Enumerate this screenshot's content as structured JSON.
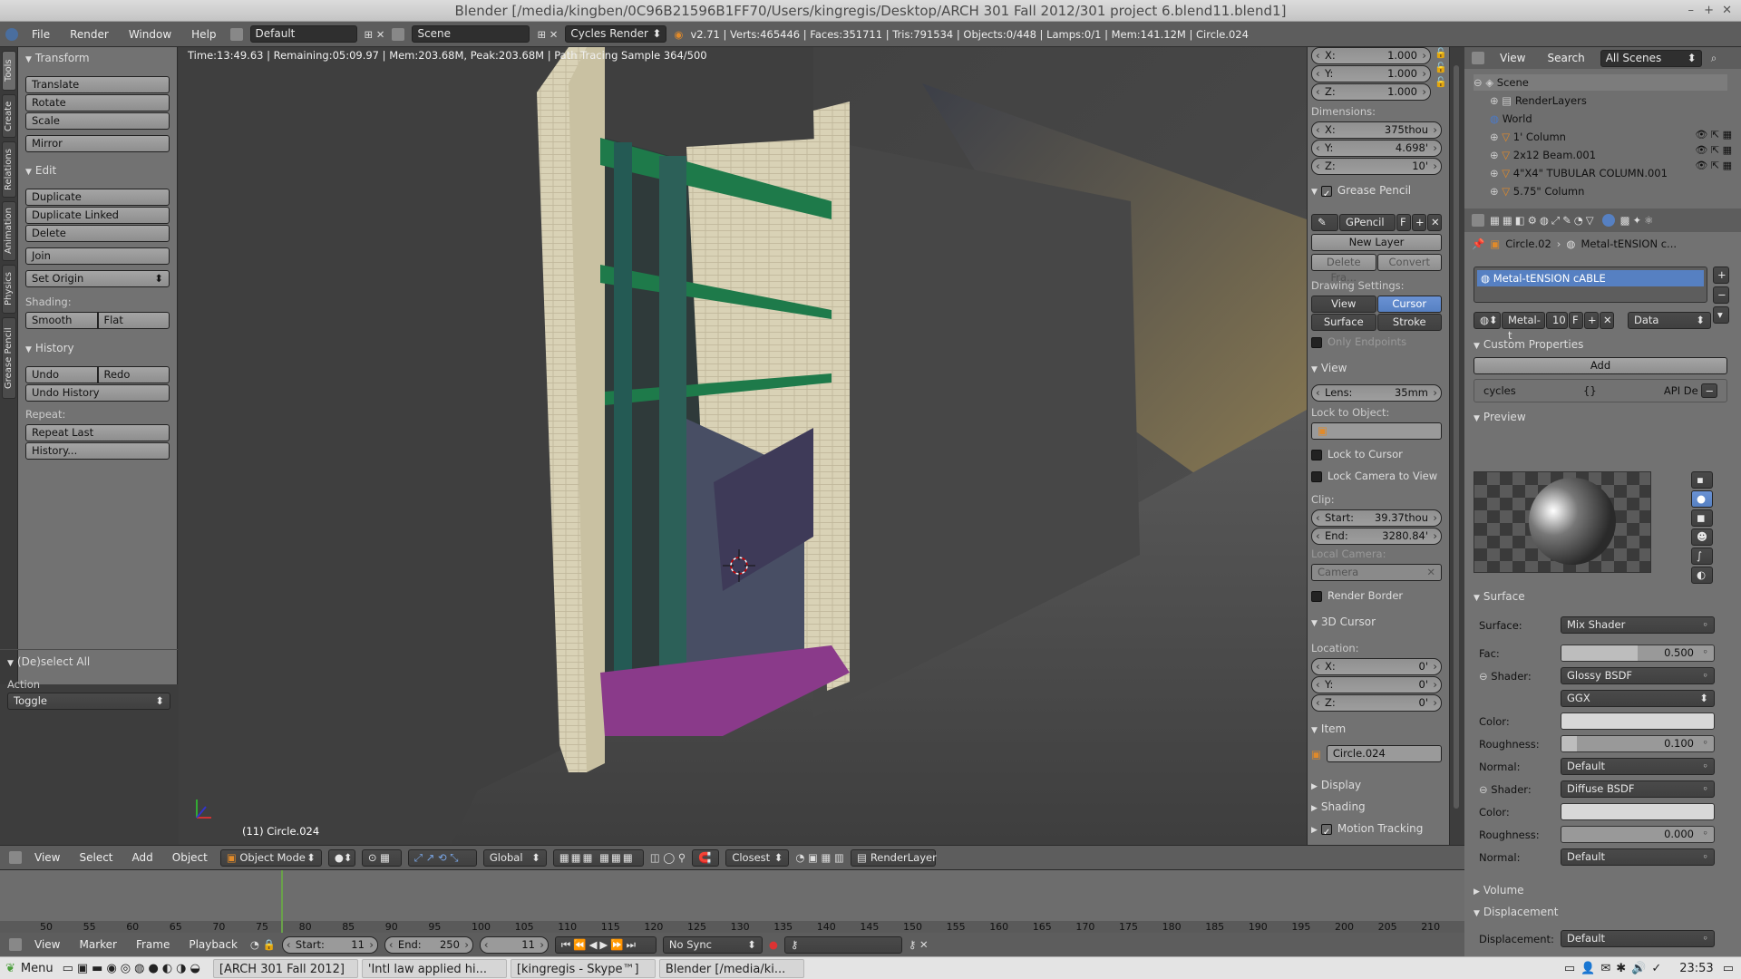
{
  "window": {
    "title": "Blender [/media/kingben/0C96B21596B1FF70/Users/kingregis/Desktop/ARCH 301 Fall 2012/301 project 6.blend11.blend1]"
  },
  "info_header": {
    "menus": [
      "File",
      "Render",
      "Window",
      "Help"
    ],
    "screen_layout": "Default",
    "scene": "Scene",
    "engine": "Cycles Render",
    "stats": "v2.71 | Verts:465446 | Faces:351711 | Tris:791534 | Objects:0/448 | Lamps:0/1 | Mem:141.12M | Circle.024"
  },
  "left_tabs": [
    "Tools",
    "Create",
    "Relations",
    "Animation",
    "Physics",
    "Grease Pencil"
  ],
  "toolshelf": {
    "transform_title": "Transform",
    "translate": "Translate",
    "rotate": "Rotate",
    "scale": "Scale",
    "mirror": "Mirror",
    "edit_title": "Edit",
    "duplicate": "Duplicate",
    "duplicate_linked": "Duplicate Linked",
    "delete": "Delete",
    "join": "Join",
    "set_origin": "Set Origin",
    "shading_label": "Shading:",
    "smooth": "Smooth",
    "flat": "Flat",
    "history_title": "History",
    "undo": "Undo",
    "redo": "Redo",
    "undo_history": "Undo History",
    "repeat_label": "Repeat:",
    "repeat_last": "Repeat Last",
    "history_btn": "History...",
    "operator_title": "(De)select All",
    "action_label": "Action",
    "action_value": "Toggle"
  },
  "viewport": {
    "render_status": "Time:13:49.63 | Remaining:05:09.97 | Mem:203.68M, Peak:203.68M | Path Tracing Sample 364/500",
    "object_label": "(11) Circle.024"
  },
  "nprops": {
    "scale": [
      {
        "axis": "X:",
        "value": "1.000"
      },
      {
        "axis": "Y:",
        "value": "1.000"
      },
      {
        "axis": "Z:",
        "value": "1.000"
      }
    ],
    "dimensions_label": "Dimensions:",
    "dimensions": [
      {
        "axis": "X:",
        "value": "375thou"
      },
      {
        "axis": "Y:",
        "value": "4.698'"
      },
      {
        "axis": "Z:",
        "value": "10'"
      }
    ],
    "grease_pencil_title": "Grease Pencil",
    "gpencil_name": "GPencil",
    "gpencil_f": "F",
    "new_layer": "New Layer",
    "delete_frame": "Delete Fra...",
    "convert": "Convert",
    "drawing_settings": "Drawing Settings:",
    "view": "View",
    "cursor": "Cursor",
    "surface": "Surface",
    "stroke": "Stroke",
    "only_endpoints": "Only Endpoints",
    "view_title": "View",
    "lens_label": "Lens:",
    "lens_value": "35mm",
    "lock_to_object": "Lock to Object:",
    "lock_to_cursor": "Lock to Cursor",
    "lock_camera": "Lock Camera to View",
    "clip_label": "Clip:",
    "clip_start_label": "Start:",
    "clip_start": "39.37thou",
    "clip_end_label": "End:",
    "clip_end": "3280.84'",
    "local_camera": "Local Camera:",
    "camera": "Camera",
    "render_border": "Render Border",
    "cursor_title": "3D Cursor",
    "location_label": "Location:",
    "cursor_loc": [
      {
        "axis": "X:",
        "value": "0'"
      },
      {
        "axis": "Y:",
        "value": "0'"
      },
      {
        "axis": "Z:",
        "value": "0'"
      }
    ],
    "item_title": "Item",
    "item_name": "Circle.024",
    "display_title": "Display",
    "shading_title": "Shading",
    "motion_tracking": "Motion Tracking"
  },
  "outliner": {
    "view": "View",
    "search": "Search",
    "filter": "All Scenes",
    "items": [
      {
        "label": "Scene",
        "indent": 0
      },
      {
        "label": "RenderLayers",
        "indent": 1
      },
      {
        "label": "World",
        "indent": 1
      },
      {
        "label": "1' Column",
        "indent": 1
      },
      {
        "label": "2x12 Beam.001",
        "indent": 1
      },
      {
        "label": "4\"X4\" TUBULAR COLUMN.001",
        "indent": 1
      },
      {
        "label": "5.75\" Column",
        "indent": 1
      }
    ]
  },
  "properties": {
    "breadcrumb_object": "Circle.02",
    "breadcrumb_material": "Metal-tENSION c...",
    "material_slot": "Metal-tENSION cABLE",
    "material_short": "Metal-t",
    "users": "10",
    "f": "F",
    "link": "Data",
    "custom_props_title": "Custom Properties",
    "add": "Add",
    "cycles": "cycles",
    "braces": "{}",
    "api": "API De",
    "preview_title": "Preview",
    "surface_title": "Surface",
    "surface_label": "Surface:",
    "surface_value": "Mix Shader",
    "fac_label": "Fac:",
    "fac_value": "0.500",
    "fac": 0.5,
    "shader_label": "Shader:",
    "shader1": "Glossy BSDF",
    "distribution": "GGX",
    "color_label": "Color:",
    "roughness_label": "Roughness:",
    "roughness1": "0.100",
    "roughness1_frac": 0.1,
    "normal_label": "Normal:",
    "normal1": "Default",
    "shader2": "Diffuse BSDF",
    "roughness2": "0.000",
    "roughness2_frac": 0,
    "normal2": "Default",
    "volume_title": "Volume",
    "displacement_title": "Displacement",
    "displacement_label": "Displacement:",
    "displacement_value": "Default"
  },
  "view3d_header": {
    "view": "View",
    "select": "Select",
    "add": "Add",
    "object": "Object",
    "mode": "Object Mode",
    "orientation": "Global",
    "snap": "Closest",
    "render_layer": "RenderLayer"
  },
  "timeline": {
    "ticks": [
      "50",
      "55",
      "60",
      "65",
      "70",
      "75",
      "80",
      "85",
      "90",
      "95",
      "100",
      "105",
      "110",
      "115",
      "120",
      "125",
      "130",
      "135",
      "140",
      "145",
      "150",
      "155",
      "160",
      "165",
      "170",
      "175",
      "180",
      "185",
      "190",
      "195",
      "200",
      "205",
      "210"
    ]
  },
  "timeline_header": {
    "view": "View",
    "marker": "Marker",
    "frame": "Frame",
    "playback": "Playback",
    "start_label": "Start:",
    "start": "11",
    "end_label": "End:",
    "end": "250",
    "current": "11",
    "sync": "No Sync"
  },
  "taskbar": {
    "menu": "Menu",
    "tasks": [
      "[ARCH 301 Fall 2012]",
      "'Intl law applied hi...",
      "[kingregis - Skype™]",
      "Blender [/media/ki..."
    ],
    "clock": "23:53"
  }
}
